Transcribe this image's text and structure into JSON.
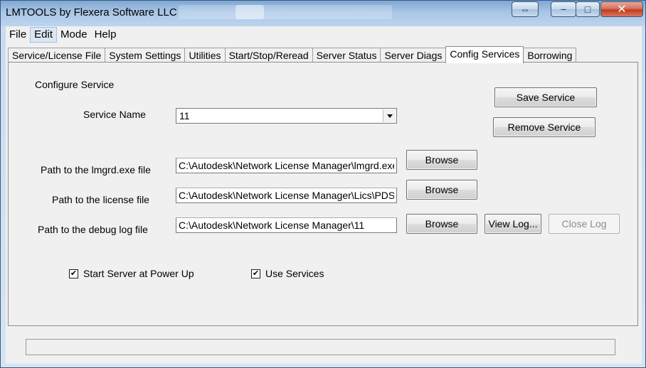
{
  "window": {
    "title": "LMTOOLS by Flexera Software LLC",
    "controls": {
      "resize": "⇔",
      "minimize": "−",
      "maximize": "□",
      "close": "✕"
    }
  },
  "menu": [
    "File",
    "Edit",
    "Mode",
    "Help"
  ],
  "tabs": [
    "Service/License File",
    "System Settings",
    "Utilities",
    "Start/Stop/Reread",
    "Server Status",
    "Server Diags",
    "Config Services",
    "Borrowing"
  ],
  "config": {
    "section_label": "Configure Service",
    "service_name_label": "Service Name",
    "service_name_value": "11",
    "save_label": "Save Service",
    "remove_label": "Remove Service",
    "lmgrd_label": "Path to the lmgrd.exe file",
    "lmgrd_value": "C:\\Autodesk\\Network License Manager\\lmgrd.exe",
    "license_label": "Path to the license file",
    "license_value": "C:\\Autodesk\\Network License Manager\\Lics\\PDSU",
    "debug_label": "Path to the debug log file",
    "debug_value": "C:\\Autodesk\\Network License Manager\\11",
    "browse_label": "Browse",
    "view_log_label": "View Log...",
    "close_log_label": "Close Log",
    "start_at_power_up_label": "Start Server at Power Up",
    "use_services_label": "Use Services",
    "check_mark": "✔"
  },
  "status": {
    "text": ""
  },
  "colors": {
    "selected_tab": "#ffffff",
    "face": "#f0f0f0",
    "title_gradient": "#a9c6e6"
  }
}
